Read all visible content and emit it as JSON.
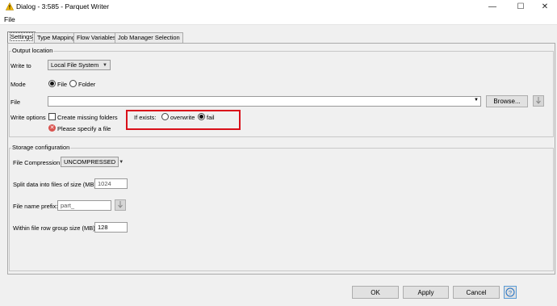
{
  "window": {
    "title": "Dialog - 3:585 - Parquet Writer",
    "minimize_glyph": "—",
    "maximize_glyph": "☐",
    "close_glyph": "✕"
  },
  "menu": {
    "file": "File"
  },
  "tabs": [
    {
      "label": "Settings",
      "active": true
    },
    {
      "label": "Type Mapping",
      "active": false
    },
    {
      "label": "Flow Variables",
      "active": false
    },
    {
      "label": "Job Manager Selection",
      "active": false
    }
  ],
  "output_location": {
    "title": "Output location",
    "write_to_label": "Write to",
    "write_to_value": "Local File System",
    "mode_label": "Mode",
    "mode_file": "File",
    "mode_folder": "Folder",
    "mode_selected": "File",
    "file_label": "File",
    "file_value": "",
    "browse_label": "Browse...",
    "write_options_label": "Write options",
    "create_missing_folders": "Create missing folders",
    "create_missing_checked": false,
    "if_exists_label": "If exists:",
    "if_exists_overwrite": "overwrite",
    "if_exists_fail": "fail",
    "if_exists_selected": "fail",
    "error_message": "Please specify a file"
  },
  "storage": {
    "title": "Storage configuration",
    "compression_label": "File Compression:",
    "compression_value": "UNCOMPRESSED",
    "split_label": "Split data into files of size (MB):",
    "split_value": "1024",
    "prefix_label": "File name prefix:",
    "prefix_value": "part_",
    "rowgroup_label": "Within file row group size (MB):",
    "rowgroup_value": "128"
  },
  "footer": {
    "ok": "OK",
    "apply": "Apply",
    "cancel": "Cancel",
    "help": "?"
  },
  "colors": {
    "highlight": "#d9101a",
    "error": "#d9534f",
    "warning": "#f2b705"
  }
}
